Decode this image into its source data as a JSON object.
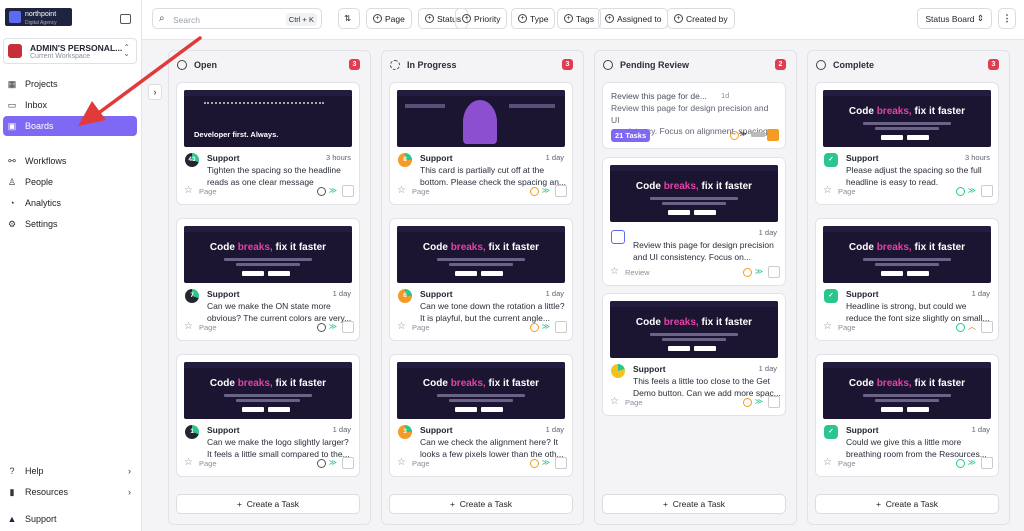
{
  "sidebar": {
    "logo_text": "northpoint",
    "logo_sub": "Digital Agency",
    "workspace": {
      "title": "ADMIN'S PERSONAL...",
      "subtitle": "Current Workspace"
    },
    "nav": [
      {
        "label": "Projects",
        "icon": "grid-icon"
      },
      {
        "label": "Inbox",
        "icon": "inbox-icon"
      },
      {
        "label": "Boards",
        "icon": "boards-icon",
        "active": true
      },
      {
        "label": "Workflows",
        "icon": "workflow-icon"
      },
      {
        "label": "People",
        "icon": "person-icon"
      },
      {
        "label": "Analytics",
        "icon": "analytics-icon"
      },
      {
        "label": "Settings",
        "icon": "gear-icon"
      }
    ],
    "bottom": [
      {
        "label": "Help",
        "icon": "help-icon"
      },
      {
        "label": "Resources",
        "icon": "resources-icon"
      },
      {
        "label": "Support",
        "icon": "support-icon"
      }
    ]
  },
  "topbar": {
    "search_placeholder": "Search",
    "search_shortcut": "Ctrl + K",
    "filters": [
      "Page",
      "Status",
      "Priority",
      "Type",
      "Tags",
      "Assigned to",
      "Created by"
    ],
    "view": "Status Board"
  },
  "columns": [
    {
      "title": "Open",
      "count": "3",
      "cards": [
        {
          "who": "Support",
          "time": "3 hours",
          "ring": "43",
          "l1": "Tighten the spacing so the headline",
          "l2": "reads as one clear message",
          "foot": "Page"
        },
        {
          "who": "Support",
          "time": "1 day",
          "ring": "7",
          "l1": "Can we make the ON state more",
          "l2": "obvious? The current colors are very...",
          "foot": "Page"
        },
        {
          "who": "Support",
          "time": "1 day",
          "ring": "1",
          "l1": "Can we make the logo slightly larger?",
          "l2": "It feels a little small compared to the...",
          "foot": "Page"
        }
      ],
      "add": "Create a Task"
    },
    {
      "title": "In Progress",
      "count": "3",
      "cards": [
        {
          "who": "Support",
          "time": "1 day",
          "ring": "8",
          "l1": "This card is partially cut off at the",
          "l2": "bottom. Please check the spacing an...",
          "foot": "Page"
        },
        {
          "who": "Support",
          "time": "1 day",
          "ring": "6",
          "l1": "Can we tone down the rotation a little?",
          "l2": "It is playful, but the current angle...",
          "foot": "Page"
        },
        {
          "who": "Support",
          "time": "1 day",
          "ring": "3",
          "l1": "Can we check the alignment here? It",
          "l2": "looks a few pixels lower than the oth...",
          "foot": "Page"
        }
      ],
      "add": "Create a Task"
    },
    {
      "title": "Pending Review",
      "count": "2",
      "review": {
        "title": "Review this page for de...",
        "time": "1d",
        "l1": "Review this page for design precision and UI",
        "l2": "consistency. Focus on alignment, spacing,...",
        "tag": "21 Tasks"
      },
      "cards": [
        {
          "who": "Review this page for design precision",
          "time": "1 day",
          "l1": "and UI consistency. Focus on...",
          "foot": "Review"
        },
        {
          "who": "Support",
          "time": "1 day",
          "l1": "This feels a little too close to the Get",
          "l2": "Demo button. Can we add more spac...",
          "foot": "Page"
        }
      ],
      "add": "Create a Task"
    },
    {
      "title": "Complete",
      "count": "3",
      "cards": [
        {
          "who": "Support",
          "time": "3 hours",
          "l1": "Please adjust the spacing so the full",
          "l2": "headline is easy to read.",
          "foot": "Page"
        },
        {
          "who": "Support",
          "time": "1 day",
          "l1": "Headline is strong, but could we",
          "l2": "reduce the font size slightly on small...",
          "foot": "Page"
        },
        {
          "who": "Support",
          "time": "1 day",
          "l1": "Could we give this a little more",
          "l2": "breathing room from the Resources...",
          "foot": "Page"
        }
      ],
      "add": "Create a Task"
    }
  ],
  "thumbs": {
    "headline_a": "Code",
    "headline_b": "breaks,",
    "headline_c": "fix it faster",
    "dev": "Developer first. Always."
  },
  "colors": {
    "accent": "#7e69f4",
    "badge": "#e03c52",
    "arrow": "#e03a3a"
  }
}
